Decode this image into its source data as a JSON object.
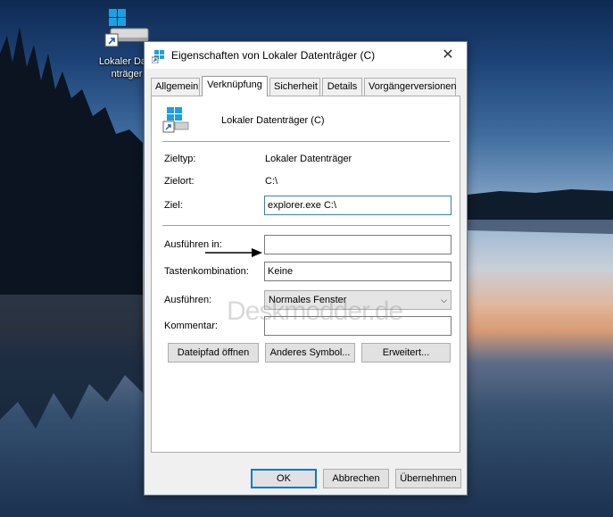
{
  "desktop": {
    "icon_label": "Lokaler Datenträger"
  },
  "dialog": {
    "title": "Eigenschaften von Lokaler Datenträger (C)",
    "close_glyph": "✕",
    "tabs": [
      {
        "label": "Allgemein",
        "active": false
      },
      {
        "label": "Verknüpfung",
        "active": true
      },
      {
        "label": "Sicherheit",
        "active": false
      },
      {
        "label": "Details",
        "active": false
      },
      {
        "label": "Vorgängerversionen",
        "active": false
      }
    ],
    "shortcut_name": "Lokaler Datenträger (C)",
    "rows": {
      "zieltyp": {
        "label": "Zieltyp:",
        "value": "Lokaler Datenträger"
      },
      "zielort": {
        "label": "Zielort:",
        "value": "C:\\"
      },
      "ziel": {
        "label": "Ziel:",
        "value": "explorer.exe C:\\"
      },
      "ausfuehren_in": {
        "label": "Ausführen in:",
        "value": ""
      },
      "tastenkombination": {
        "label": "Tastenkombination:",
        "value": "Keine"
      },
      "ausfuehren": {
        "label": "Ausführen:",
        "value": "Normales Fenster"
      },
      "kommentar": {
        "label": "Kommentar:",
        "value": ""
      }
    },
    "buttons": {
      "dateipfad": "Dateipfad öffnen",
      "anderes_symbol": "Anderes Symbol...",
      "erweitert": "Erweitert...",
      "ok": "OK",
      "abbrechen": "Abbrechen",
      "uebernehmen": "Übernehmen"
    },
    "watermark": "Deskmodder.de"
  },
  "colors": {
    "windows_blue": "#1ba1e2",
    "focus_border": "#3c7fb1",
    "default_button": "#0078d7"
  }
}
